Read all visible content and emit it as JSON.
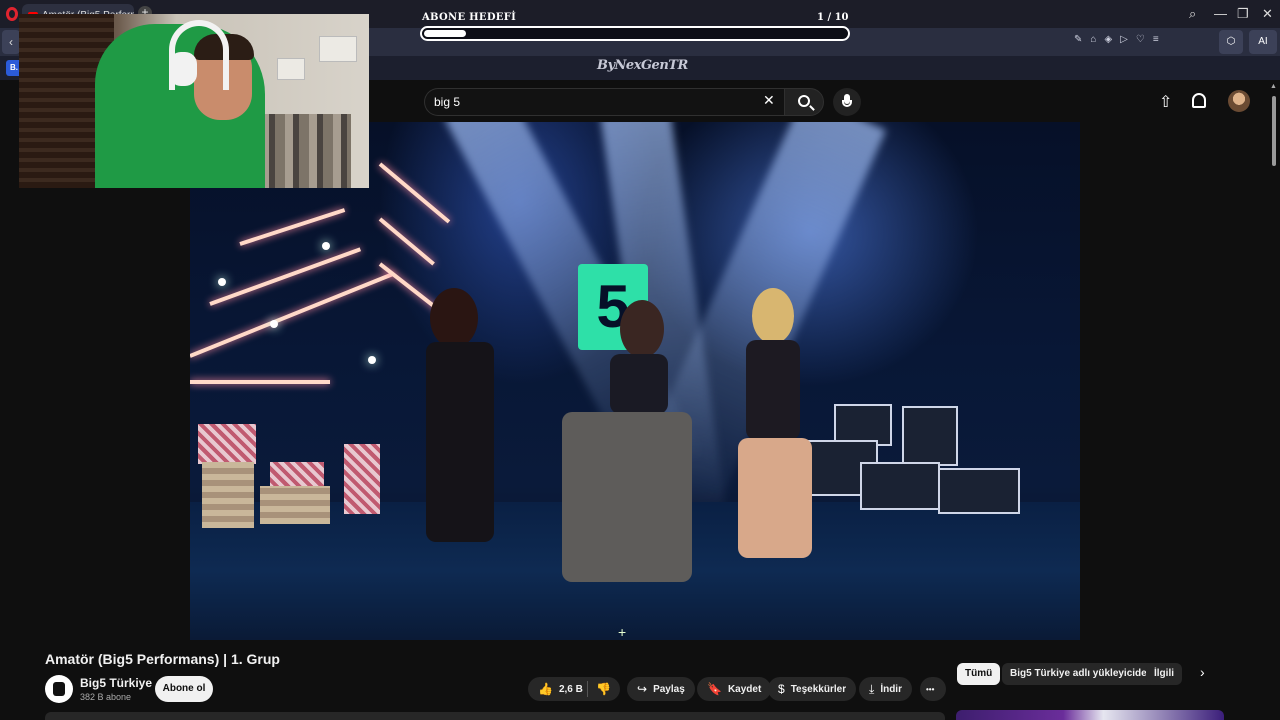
{
  "browser": {
    "tab_title": "Amatör (Big5 Perform",
    "new_tab": "+",
    "window_controls": [
      "⌕",
      "—",
      "❐",
      "✕"
    ],
    "back": "‹",
    "extension_icons": [
      "✎",
      "⌂",
      "◈",
      "▷",
      "♡",
      "≡"
    ],
    "aria_label": "AI",
    "bookmark_letter": "B."
  },
  "goal_overlay": {
    "label": "ABONE HEDEFİ",
    "count": "1   / 10",
    "progress": 0.1
  },
  "overlay_logo": "ByNexGenTR",
  "search": {
    "value": "big 5",
    "clear": "✕"
  },
  "header_icons": {
    "upload": "⇧"
  },
  "video": {
    "title": "Amatör (Big5 Performans) | 1. Grup",
    "logo_text": "5",
    "crosshair": "+"
  },
  "channel": {
    "name": "Big5 Türkiye",
    "subscribers": "382 B abone",
    "subscribe_label": "Abone ol"
  },
  "actions": {
    "like_icon": "👍",
    "like_count": "2,6 B",
    "dislike_icon": "👎",
    "share_icon": "↪",
    "share_label": "Paylaş",
    "save_icon": "🔖",
    "save_label": "Kaydet",
    "thanks_icon": "$",
    "thanks_label": "Teşekkürler",
    "download_icon": "⤓",
    "download_label": "İndir",
    "more": "•••"
  },
  "chips": {
    "items": [
      "Tümü",
      "Big5 Türkiye adlı yükleyiciden",
      "İlgili"
    ],
    "next": "›"
  }
}
